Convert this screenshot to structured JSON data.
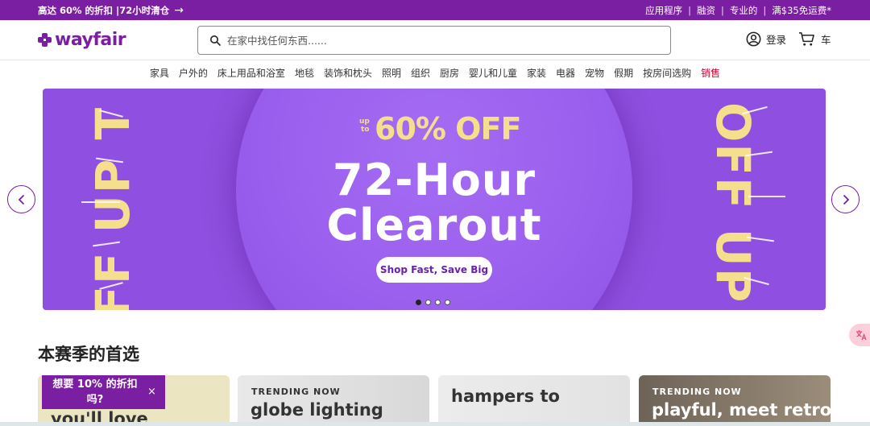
{
  "topbar": {
    "promo_text": "高达 60% 的折扣 |72小时清仓",
    "promo_arrow": "→",
    "links": [
      "应用程序",
      "融资",
      "专业的",
      "满$35免运费*"
    ],
    "separator": "|"
  },
  "header": {
    "logo_text": "wayfair",
    "search_placeholder": "在家中找任何东西......",
    "account_label": "登录",
    "cart_label": "车"
  },
  "nav": {
    "categories": [
      "家具",
      "户外的",
      "床上用品和浴室",
      "地毯",
      "装饰和枕头",
      "照明",
      "组织",
      "厨房",
      "婴儿和儿童",
      "家装",
      "电器",
      "宠物",
      "假期",
      "按房间选购"
    ],
    "sale": "销售"
  },
  "hero": {
    "up": "up",
    "to": "to",
    "percent_off": "60% OFF",
    "title_line1": "72-Hour",
    "title_line2": "Clearout",
    "cta": "Shop Fast, Save Big",
    "side_text": "OFF UP T",
    "slide_count": 4,
    "active_slide": 1
  },
  "section": {
    "title": "本赛季的首选",
    "cards": [
      {
        "kicker": "",
        "title": "you'll love"
      },
      {
        "kicker": "TRENDING NOW",
        "title": "globe lighting"
      },
      {
        "kicker": "",
        "title": "hampers to"
      },
      {
        "kicker": "TRENDING NOW",
        "title": "playful, meet retro"
      }
    ]
  },
  "popup": {
    "text": "想要 10% 的折扣吗?",
    "close": "×"
  },
  "help_icon": "translate-icon",
  "colors": {
    "brand": "#7b1fa2",
    "hero_bg": "#8f4fe0",
    "accent_yellow": "#f6df8c",
    "sale": "#c4002f"
  }
}
